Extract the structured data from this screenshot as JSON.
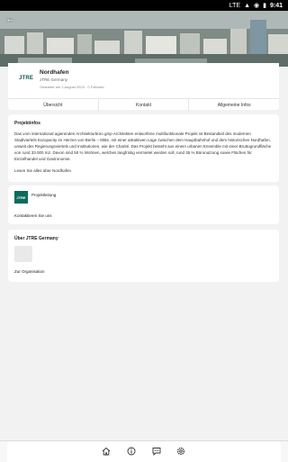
{
  "status": {
    "time": "9:41",
    "network": "LTE"
  },
  "header": {
    "title": "Nordhafen",
    "company": "JTRE Germany",
    "meta": "Gestartet am 1 August 2024 · 0 Follower",
    "logo_text": "JTRE"
  },
  "tabs": [
    "Übersicht",
    "Kontakt",
    "Allgemeine Infos"
  ],
  "project_info": {
    "title": "Projektinfos",
    "text": "Das vom international agierenden Architekturbüro gmp Architekten entworfene multifunktionale Projekt ist Bestandteil des modernen Stadtviertels Europacity im Herzen von Berlin – Mitte, mit einer attraktiven Lage zwischen dem Hauptbahnhof und dem historischen Nordhafen, unweit des Regierungsviertels und Institutionen, wie der Charité. Das Projekt besteht aus einem urbanen Ensemble mit einer Bruttogrundfläche von rund 33.000 m2. Davon sind 50 % Wohnen, welches langfristig vermietet werden soll, rund 35 % Büronutzung sowie Flächen für Einzelhandel und Gastronomie.",
    "link": "Lesen Sie alles über Nordhafen"
  },
  "lead": {
    "label": "Projektleitung",
    "logo_text": "JTRE",
    "link": "Kontaktieren Sie uns"
  },
  "org": {
    "title": "Über JTRE Germany",
    "link": "Zur Organisation"
  },
  "bottom_nav": [
    "home-icon",
    "info-icon",
    "chat-icon",
    "settings-icon"
  ],
  "colors": {
    "brand": "#0b6b5b"
  }
}
